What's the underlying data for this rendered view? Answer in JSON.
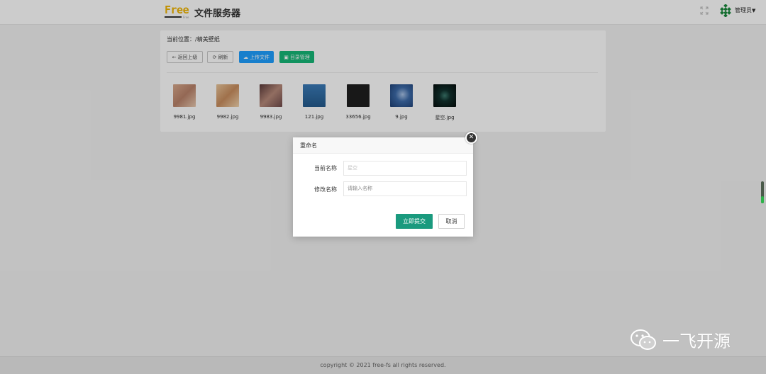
{
  "header": {
    "logo_text": "Free",
    "logo_sub": "Free",
    "title": "文件服务器",
    "user_label": "管理员",
    "icons": [
      "fullscreen-icon",
      "avatar",
      "caret-down-icon"
    ]
  },
  "panel": {
    "breadcrumb": "当前位置：/精美壁纸",
    "toolbar": {
      "back_label": "返回上级",
      "refresh_label": "刷新",
      "upload_label": "上传文件",
      "dir_label": "目录管理"
    },
    "files": [
      {
        "name": "9981.jpg",
        "thumb_color": "#c9957a"
      },
      {
        "name": "9982.jpg",
        "thumb_color": "#d9a97a"
      },
      {
        "name": "9983.jpg",
        "thumb_color": "#8a5a5a"
      },
      {
        "name": "121.jpg",
        "thumb_color": "#2e6ea6"
      },
      {
        "name": "33656.jpg",
        "thumb_color": "#1f1f1f"
      },
      {
        "name": "9.jpg",
        "thumb_color": "#3c6aa8"
      },
      {
        "name": "星空.jpg",
        "thumb_color": "#0c1a18"
      }
    ]
  },
  "modal": {
    "title": "重命名",
    "current_name_label": "当前名称",
    "current_name_value": "星空",
    "new_name_label": "修改名称",
    "new_name_placeholder": "请输入名称",
    "submit_label": "立即提交",
    "cancel_label": "取消"
  },
  "footer": {
    "copyright": "copyright © 2021 free-fs all rights reserved."
  },
  "watermark": {
    "text": "一飞开源"
  },
  "colors": {
    "primary_green": "#1a9a7e",
    "upload_blue": "#1e9fff",
    "dir_green": "#16b777",
    "logo_yellow": "#f0b400"
  }
}
